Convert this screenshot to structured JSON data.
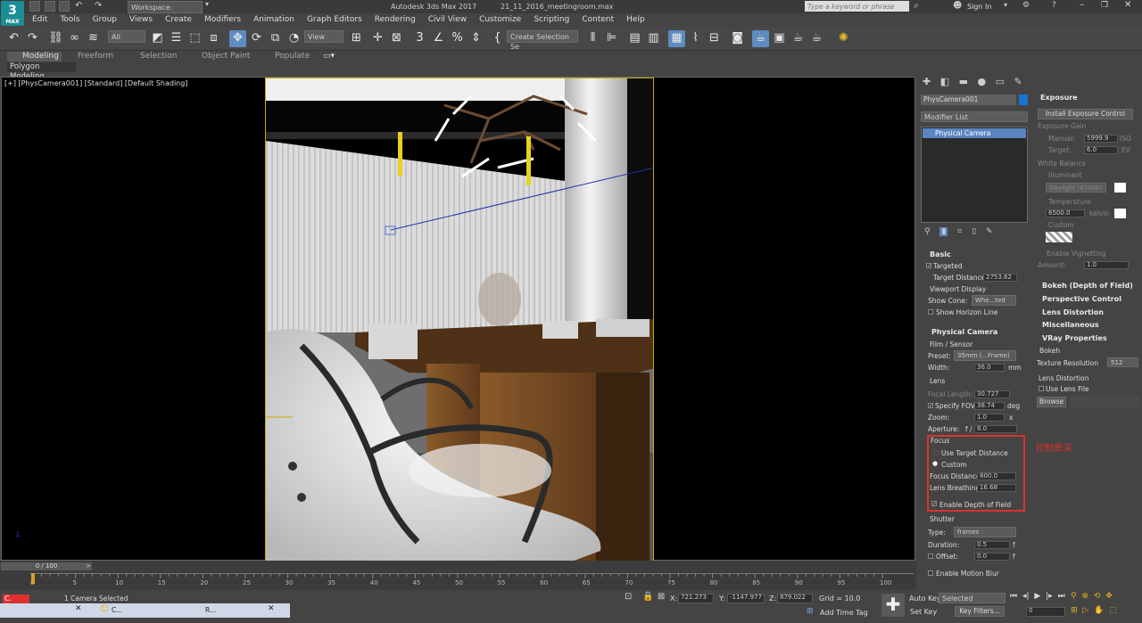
{
  "title_bar": {
    "workspace": "Workspace: Default",
    "app": "Autodesk 3ds Max 2017",
    "file": "21_11_2016_meetingroom.max",
    "search_placeholder": "Type a keyword or phrase",
    "sign_in": "Sign In"
  },
  "menu": [
    "Edit",
    "Tools",
    "Group",
    "Views",
    "Create",
    "Modifiers",
    "Animation",
    "Graph Editors",
    "Rendering",
    "Civil View",
    "Customize",
    "Scripting",
    "Content",
    "Help"
  ],
  "toolbar": {
    "filter": "All",
    "ref_coord": "View",
    "selection_set": "Create Selection Se"
  },
  "ribbon": {
    "tabs": [
      "Modeling",
      "Freeform",
      "Selection",
      "Object Paint",
      "Populate"
    ],
    "sub": "Polygon Modeling"
  },
  "viewport": {
    "label": "[+] [PhysCamera001] [Standard] [Default Shading]"
  },
  "command_panel": {
    "object_name": "PhysCamera001",
    "color": "#1874d2",
    "modifier_list": "Modifier List",
    "stack_item": "Physical Camera",
    "basic": {
      "header": "Basic",
      "targeted": "Targeted",
      "target_distance_label": "Target Distance:",
      "target_distance": "2753.62",
      "viewport_display": "Viewport Display",
      "show_cone_label": "Show Cone:",
      "show_cone": "Whe...ted",
      "show_horizon": "Show Horizon Line"
    },
    "physical": {
      "header": "Physical Camera",
      "film_sensor": "Film / Sensor",
      "preset_label": "Preset:",
      "preset": "35mm (...Frame)",
      "width_label": "Width:",
      "width": "36.0",
      "width_unit": "mm",
      "lens": "Lens",
      "focal_length_label": "Focal Length:",
      "focal_length": "30.727",
      "specify_fov": "Specify FOV:",
      "fov": "38.74",
      "fov_unit": "deg",
      "zoom_label": "Zoom:",
      "zoom": "1.0",
      "zoom_unit": "x",
      "aperture_label": "Aperture:",
      "aperture_prefix": "f /",
      "aperture": "8.0",
      "focus": "Focus",
      "use_target": "Use Target Distance",
      "custom": "Custom",
      "focus_distance_label": "Focus Distance:",
      "focus_distance": "800.0",
      "lens_breathing_label": "Lens Breathing:",
      "lens_breathing": "16.68",
      "enable_dof": "Enable Depth of Field",
      "shutter": "Shutter",
      "type_label": "Type:",
      "type": "frames",
      "duration_label": "Duration:",
      "duration": "0.5",
      "duration_unit": "f",
      "offset_label": "Offset:",
      "offset": "0.0",
      "offset_unit": "f",
      "motion_blur": "Enable Motion Blur"
    }
  },
  "annotation": {
    "text": "控制景深",
    "color": "#e03030"
  },
  "right_panel": {
    "exposure": {
      "header": "Exposure",
      "install_btn": "Install Exposure Control",
      "gain": "Exposure Gain",
      "manual": "Manual:",
      "manual_val": "5999.9",
      "manual_unit": "ISO",
      "target": "Target:",
      "target_val": "6.0",
      "target_unit": "EV",
      "white_balance": "White Balance",
      "illuminant": "Illuminant",
      "daylight": "Daylight (6500K)",
      "temperature": "Temperature",
      "temp_val": "6500.0",
      "temp_unit": "kelvin",
      "custom": "Custom",
      "vignetting": "Enable Vignetting",
      "amount_label": "Amount:",
      "amount": "1.0"
    },
    "rollouts": [
      "Bokeh (Depth of Field)",
      "Perspective Control",
      "Lens Distortion",
      "Miscellaneous"
    ],
    "vray": {
      "header": "VRay Properties",
      "bokeh": "Bokeh",
      "tex_res_label": "Texture Resolution",
      "tex_res": "512",
      "lens_distortion": "Lens Distortion",
      "use_lens_file": "Use Lens File",
      "browse": "Browse"
    }
  },
  "timeline": {
    "frame": "0 / 100",
    "ticks": [
      "0",
      "5",
      "10",
      "15",
      "20",
      "25",
      "30",
      "35",
      "40",
      "45",
      "50",
      "55",
      "60",
      "65",
      "70",
      "75",
      "80",
      "85",
      "90",
      "95",
      "100"
    ]
  },
  "status": {
    "selected": "1 Camera Selected",
    "x_label": "X:",
    "x": "721.273",
    "y_label": "Y:",
    "y": "-1147.977",
    "z_label": "Z:",
    "z": "879.022",
    "grid": "Grid = 10.0",
    "add_time_tag": "Add Time Tag",
    "auto_key": "Auto Key",
    "set_key": "Set Key",
    "key_mode": "Selected",
    "key_filters": "Key Filters...",
    "current_frame": "0",
    "task_c": "C...",
    "task_r": "R..."
  }
}
